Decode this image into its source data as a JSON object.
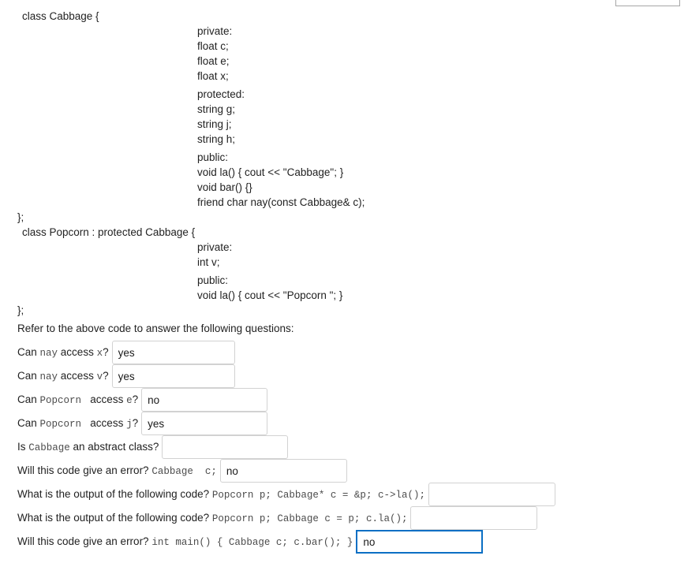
{
  "code_listing": {
    "cabbage_open": "class Cabbage {",
    "cabbage_close": "};",
    "popcorn_open": "class Popcorn : protected Cabbage {",
    "popcorn_close": "};",
    "cabbage_groups": [
      {
        "name": "private-group",
        "lines": [
          "private:",
          "float c;",
          "float e;",
          "float x;"
        ]
      },
      {
        "name": "protected-group",
        "lines": [
          "protected:",
          "string g;",
          "string j;",
          "string h;"
        ]
      },
      {
        "name": "public-group",
        "lines": [
          "public:",
          "void la() { cout << \"Cabbage\"; }",
          "void bar() {}",
          "friend char nay(const Cabbage& c);"
        ]
      }
    ],
    "popcorn_groups": [
      {
        "name": "private-group",
        "lines": [
          "private:",
          "int v;"
        ]
      },
      {
        "name": "public-group",
        "lines": [
          "public:",
          "void la() { cout << \"Popcorn \"; }"
        ]
      }
    ]
  },
  "instruction": "Refer to the above code to answer the following questions:",
  "questions": [
    {
      "id": "nay-access-x",
      "parts": [
        {
          "type": "text",
          "text": "Can "
        },
        {
          "type": "code",
          "text": "nay"
        },
        {
          "type": "text",
          "text": " access "
        },
        {
          "type": "code",
          "text": "x"
        },
        {
          "type": "text",
          "text": "?"
        }
      ],
      "value": "yes",
      "placeholder": "",
      "width": "w-narrow",
      "focused": false
    },
    {
      "id": "nay-access-v",
      "parts": [
        {
          "type": "text",
          "text": "Can "
        },
        {
          "type": "code",
          "text": "nay"
        },
        {
          "type": "text",
          "text": " access "
        },
        {
          "type": "code",
          "text": "v"
        },
        {
          "type": "text",
          "text": "?"
        }
      ],
      "value": "yes",
      "placeholder": "",
      "width": "w-narrow",
      "focused": false
    },
    {
      "id": "popcorn-access-e",
      "parts": [
        {
          "type": "text",
          "text": "Can "
        },
        {
          "type": "code",
          "text": "Popcorn "
        },
        {
          "type": "text",
          "text": " access "
        },
        {
          "type": "code",
          "text": "e"
        },
        {
          "type": "text",
          "text": "?"
        }
      ],
      "value": "no",
      "placeholder": "",
      "width": "w-mid",
      "focused": false
    },
    {
      "id": "popcorn-access-j",
      "parts": [
        {
          "type": "text",
          "text": "Can "
        },
        {
          "type": "code",
          "text": "Popcorn "
        },
        {
          "type": "text",
          "text": " access "
        },
        {
          "type": "code",
          "text": "j"
        },
        {
          "type": "text",
          "text": "?"
        }
      ],
      "value": "yes",
      "placeholder": "",
      "width": "w-mid",
      "focused": false
    },
    {
      "id": "cabbage-abstract",
      "parts": [
        {
          "type": "text",
          "text": "Is "
        },
        {
          "type": "code",
          "text": "Cabbage"
        },
        {
          "type": "text",
          "text": " an abstract class?"
        }
      ],
      "value": "",
      "placeholder": "",
      "width": "w-mid",
      "focused": false
    },
    {
      "id": "error-cabbage-c",
      "parts": [
        {
          "type": "text",
          "text": "Will this code give an error? "
        },
        {
          "type": "code",
          "text": "Cabbage  c;"
        }
      ],
      "value": "no",
      "placeholder": "",
      "width": "w-wide",
      "focused": false
    },
    {
      "id": "output-pointer-la",
      "parts": [
        {
          "type": "text",
          "text": "What is the output of the following code? "
        },
        {
          "type": "code",
          "text": "Popcorn p; Cabbage* c = &p; c->la();"
        }
      ],
      "value": "",
      "placeholder": "",
      "width": "w-wide",
      "focused": false
    },
    {
      "id": "output-slice-la",
      "parts": [
        {
          "type": "text",
          "text": "What is the output of the following code? "
        },
        {
          "type": "code",
          "text": "Popcorn p; Cabbage c = p; c.la();"
        }
      ],
      "value": "",
      "placeholder": "",
      "width": "w-wide",
      "focused": false
    },
    {
      "id": "error-main-bar",
      "parts": [
        {
          "type": "text",
          "text": "Will this code give an error? "
        },
        {
          "type": "code",
          "text": "int main() { Cabbage c; c.bar(); }"
        }
      ],
      "value": "no",
      "placeholder": "",
      "width": "w-wide",
      "focused": true
    }
  ],
  "colors": {
    "focus_border": "#0b6fc4",
    "input_border": "#d2d2d2",
    "text": "#222222",
    "code_text": "#4c4c4c",
    "background": "#ffffff"
  }
}
